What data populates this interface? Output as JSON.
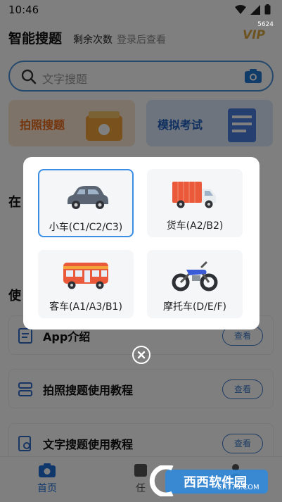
{
  "status": {
    "time": "10:46",
    "badge": "5624"
  },
  "header": {
    "title": "智能搜题",
    "remaining": "剩余次数",
    "login_hint": "登录后查看",
    "vip": "VIP"
  },
  "search": {
    "placeholder": "文字搜题"
  },
  "cards": {
    "photo": "拍照搜题",
    "exam": "模拟考试"
  },
  "background": {
    "section1": "在",
    "section2": "使",
    "rows": [
      {
        "label": "App介绍",
        "button": "查看"
      },
      {
        "label": "拍照搜题使用教程",
        "button": "查看"
      },
      {
        "label": "文字搜题使用教程",
        "button": "查看"
      }
    ]
  },
  "dialog": {
    "vehicles": [
      {
        "label": "小车(C1/C2/C3)",
        "selected": true
      },
      {
        "label": "货车(A2/B2)",
        "selected": false
      },
      {
        "label": "客车(A1/A3/B1)",
        "selected": false
      },
      {
        "label": "摩托车(D/E/F)",
        "selected": false
      }
    ]
  },
  "tabbar": {
    "home": "首页",
    "task": "任",
    "me": ""
  },
  "watermark": {
    "text": "西西软件园",
    "site": "CR173.COM"
  },
  "colors": {
    "accent": "#3a8ee6",
    "primary": "#1f6fd6",
    "vip": "#d8a640"
  }
}
